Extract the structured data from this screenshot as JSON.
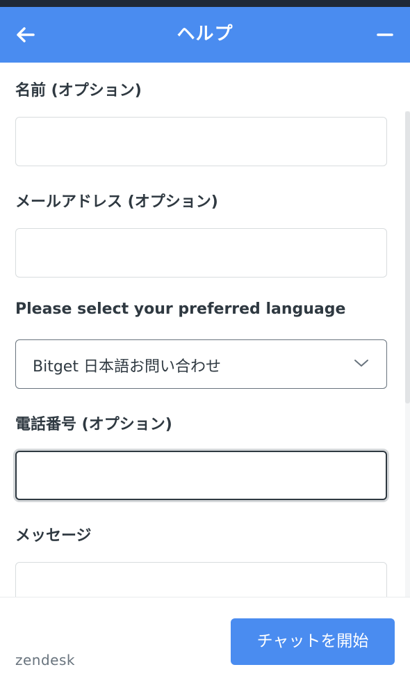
{
  "header": {
    "title": "ヘルプ",
    "back_icon": "arrow-left-icon",
    "minimize_icon": "minimize-icon",
    "color": "#4a8cf0"
  },
  "form": {
    "name_label": "名前 (オプション)",
    "name_value": "",
    "email_label": "メールアドレス (オプション)",
    "email_value": "",
    "language_label": "Please select your preferred language",
    "language_selected": "Bitget 日本語お問い合わせ",
    "phone_label": "電話番号 (オプション)",
    "phone_value": "",
    "message_label": "メッセージ",
    "message_value": ""
  },
  "footer": {
    "brand": "zendesk",
    "start_chat_label": "チャットを開始"
  }
}
